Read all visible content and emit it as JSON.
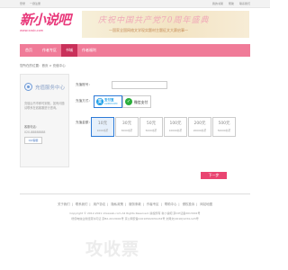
{
  "topbar": {
    "left": [
      "登录",
      "一键注册"
    ],
    "right": [
      "我的书架",
      "帮助",
      "联系我们"
    ]
  },
  "logo": {
    "text": "新小说吧",
    "url": "www.xxsb.com"
  },
  "banner": {
    "big": "庆祝中国共产党70周年盛典",
    "small": "一国家全国网络文学现实题材主题征文大赛启事一"
  },
  "nav": {
    "items": [
      "首页",
      "作者专区",
      "书城",
      "作者福利"
    ],
    "active_index": 2
  },
  "breadcrumb": "您所在的位置：首页 > 充值中心",
  "sidebar": {
    "title": "充值服务中心",
    "desc": "充值后书币即时到账，如有问题请联系在线客服进行咨询。",
    "tel_label": "客服电话：",
    "tel": "020-88888888",
    "qq": "QQ客服"
  },
  "form": {
    "account_label": "充值账号：",
    "method_label": "充值方式：",
    "amount_label": "充值金额：",
    "alipay_title": "支付宝",
    "alipay_sub": "ALIPAY.COM",
    "wechat": "微信支付",
    "amounts": [
      {
        "value": "10元",
        "note": "1000书币"
      },
      {
        "value": "30元",
        "note": "3000书币"
      },
      {
        "value": "50元",
        "note": "5000书币"
      },
      {
        "value": "100元",
        "note": "10000书币"
      },
      {
        "value": "200元",
        "note": "20000书币"
      },
      {
        "value": "500元",
        "note": "50000书币"
      }
    ],
    "selected_amount": 0,
    "next": "下一步"
  },
  "footer": {
    "links": [
      "关于我们",
      "联系我们",
      "用户协议",
      "隐私政策",
      "服务条款",
      "作者专区",
      "帮助中心",
      "侵权投诉",
      "网站地图"
    ],
    "copy1": "Copyright © 2012-2021 xhsxwsb.com All Rights Reserved. 版权所有 新小说吧 京ICP证备2013001号",
    "copy2": "增值电信业务经营许可证 京B2-2013001号 京公网安备11010502031234号 文网文[2016]1234-123号"
  },
  "watermark": "攻收票"
}
